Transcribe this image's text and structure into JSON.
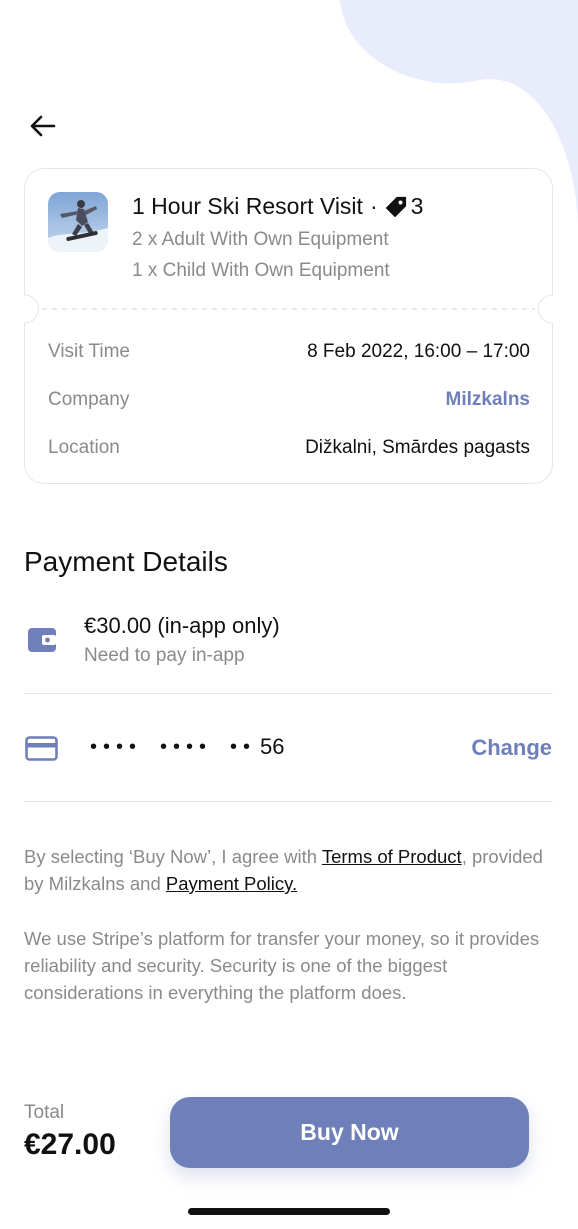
{
  "ticket": {
    "title": "1 Hour Ski Resort Visit",
    "separator": "·",
    "ticket_count": "3",
    "lines": [
      "2 x Adult With Own Equipment",
      "1 x Child With Own Equipment"
    ],
    "details": [
      {
        "label": "Visit Time",
        "value": "8 Feb 2022, 16:00 – 17:00"
      },
      {
        "label": "Company",
        "value": "Milzkalns"
      },
      {
        "label": "Location",
        "value": "Dižkalni, Smārdes pagasts"
      }
    ]
  },
  "payment": {
    "title": "Payment Details",
    "amount": "€30.00 (in-app only)",
    "amount_note": "Need to pay in-app",
    "card_group1": "••••",
    "card_group2": "••••",
    "card_group3": "••",
    "card_last": "56",
    "change_label": "Change"
  },
  "legal": {
    "prefix": "By selecting ‘Buy Now’, I agree with ",
    "terms_link": "Terms of Product",
    "middle": ", provided by Milzkalns and ",
    "policy_link": "Payment Policy."
  },
  "info_text": "We use Stripe’s platform for transfer your money, so it provides reliability and security. Security is one of the biggest considerations in everything the platform does.",
  "footer": {
    "total_label": "Total",
    "total_value": "€27.00",
    "buy_label": "Buy Now"
  },
  "colors": {
    "accent": "#6f7fb9",
    "blob": "#e9edfb"
  },
  "icons": {
    "back": "arrow-left-icon",
    "tag": "ticket-tag-icon",
    "wallet": "wallet-icon",
    "card": "credit-card-icon"
  }
}
